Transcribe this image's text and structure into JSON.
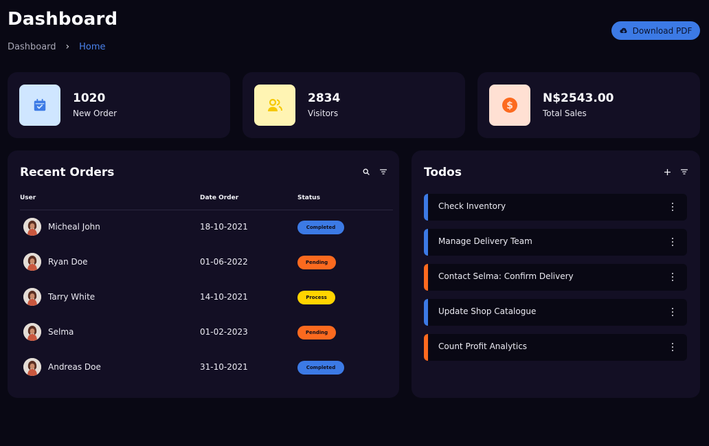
{
  "header": {
    "title": "Dashboard",
    "breadcrumb": [
      "Dashboard",
      "Home"
    ],
    "download_label": "Download PDF"
  },
  "stats": [
    {
      "value": "1020",
      "label": "New Order",
      "icon": "calendar-check-icon",
      "bg": "#cfe6ff",
      "color": "#3c7ae5"
    },
    {
      "value": "2834",
      "label": "Visitors",
      "icon": "users-icon",
      "bg": "#fff4b3",
      "color": "#f5c800"
    },
    {
      "value": "N$2543.00",
      "label": "Total Sales",
      "icon": "dollar-circle-icon",
      "bg": "#ffe0d3",
      "color": "#fc6a1f"
    }
  ],
  "orders": {
    "title": "Recent Orders",
    "columns": [
      "User",
      "Date Order",
      "Status"
    ],
    "rows": [
      {
        "user": "Micheal John",
        "date": "18-10-2021",
        "status": "Completed"
      },
      {
        "user": "Ryan Doe",
        "date": "01-06-2022",
        "status": "Pending"
      },
      {
        "user": "Tarry White",
        "date": "14-10-2021",
        "status": "Process"
      },
      {
        "user": "Selma",
        "date": "01-02-2023",
        "status": "Pending"
      },
      {
        "user": "Andreas Doe",
        "date": "31-10-2021",
        "status": "Completed"
      }
    ]
  },
  "todos": {
    "title": "Todos",
    "items": [
      {
        "text": "Check Inventory",
        "state": "completed"
      },
      {
        "text": "Manage Delivery Team",
        "state": "completed"
      },
      {
        "text": "Contact Selma: Confirm Delivery",
        "state": "pending"
      },
      {
        "text": "Update Shop Catalogue",
        "state": "completed"
      },
      {
        "text": "Count Profit Analytics",
        "state": "pending"
      }
    ]
  },
  "colors": {
    "accent": "#3c7ae5",
    "completed": "#3c7ae5",
    "pending": "#fc6a1f",
    "process": "#ffd400",
    "background": "#090814",
    "card": "#130f24"
  }
}
